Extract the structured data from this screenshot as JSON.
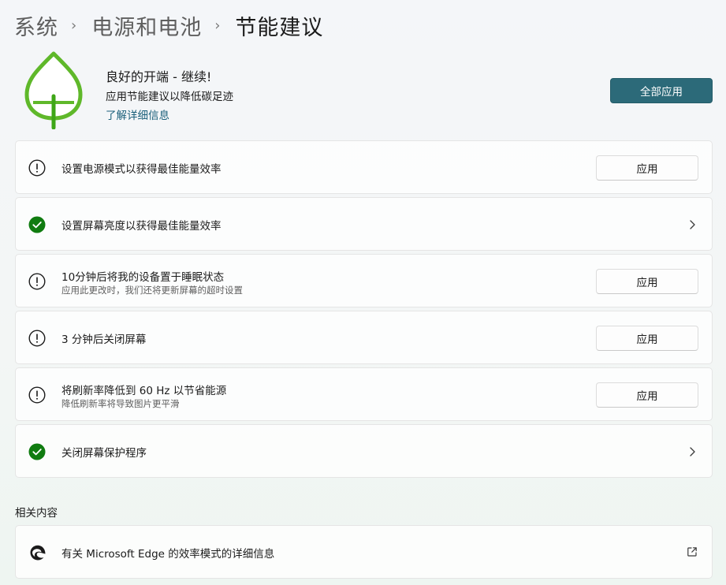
{
  "breadcrumb": {
    "items": [
      "系统",
      "电源和电池"
    ],
    "current": "节能建议",
    "separator": "›"
  },
  "hero": {
    "title": "良好的开端 - 继续!",
    "subtitle": "应用节能建议以降低碳足迹",
    "link": "了解详细信息",
    "apply_all_label": "全部应用",
    "icon": "leaf-icon"
  },
  "recommendations": [
    {
      "status": "warning",
      "title": "设置电源模式以获得最佳能量效率",
      "subtitle": "",
      "action": "应用"
    },
    {
      "status": "done",
      "title": "设置屏幕亮度以获得最佳能量效率",
      "subtitle": "",
      "action": ""
    },
    {
      "status": "warning",
      "title": "10分钟后将我的设备置于睡眠状态",
      "subtitle": "应用此更改时，我们还将更新屏幕的超时设置",
      "action": "应用"
    },
    {
      "status": "warning",
      "title": "3 分钟后关闭屏幕",
      "subtitle": "",
      "action": "应用"
    },
    {
      "status": "warning",
      "title": "将刷新率降低到 60 Hz 以节省能源",
      "subtitle": "降低刷新率将导致图片更平滑",
      "action": "应用"
    },
    {
      "status": "done",
      "title": "关闭屏幕保护程序",
      "subtitle": "",
      "action": ""
    }
  ],
  "related": {
    "label": "相关内容",
    "items": [
      {
        "title": "有关 Microsoft Edge 的效率模式的详细信息",
        "icon": "edge-icon"
      }
    ]
  },
  "colors": {
    "accent": "#2c6a79",
    "link": "#1a5f7a",
    "success": "#107c10",
    "leaf": "#5fb82a"
  }
}
